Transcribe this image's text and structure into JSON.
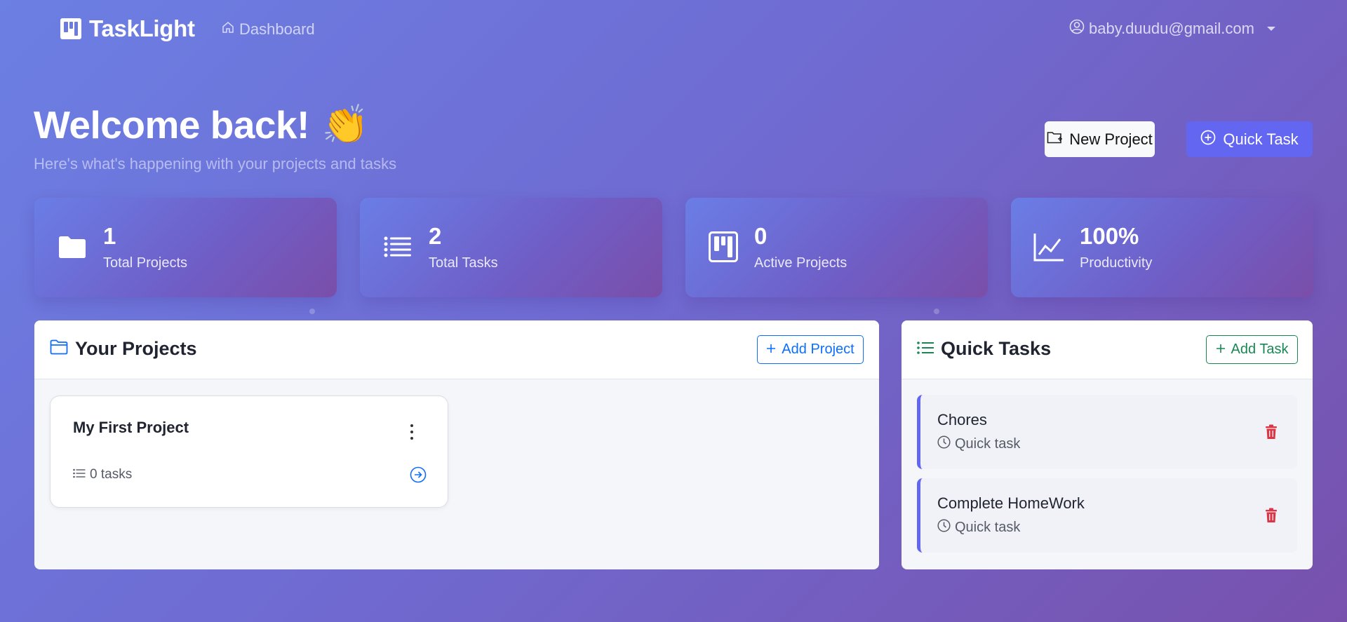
{
  "nav": {
    "brand": "TaskLight",
    "dashboard_link": "Dashboard",
    "user_email": "baby.duudu@gmail.com"
  },
  "hero": {
    "title": "Welcome back!",
    "emoji": "👏",
    "subtitle": "Here's what's happening with your projects and tasks",
    "new_project_label": "New Project",
    "quick_task_label": "Quick Task"
  },
  "stats": [
    {
      "value": "1",
      "label": "Total Projects",
      "icon": "folder-icon"
    },
    {
      "value": "2",
      "label": "Total Tasks",
      "icon": "list-icon"
    },
    {
      "value": "0",
      "label": "Active Projects",
      "icon": "kanban-icon"
    },
    {
      "value": "100%",
      "label": "Productivity",
      "icon": "graph-up-icon"
    }
  ],
  "projects_panel": {
    "title": "Your Projects",
    "add_label": "Add Project",
    "projects": [
      {
        "name": "My First Project",
        "task_count": "0 tasks"
      }
    ]
  },
  "tasks_panel": {
    "title": "Quick Tasks",
    "add_label": "Add Task",
    "tasks": [
      {
        "title": "Chores",
        "meta": "Quick task"
      },
      {
        "title": "Complete HomeWork",
        "meta": "Quick task"
      }
    ]
  },
  "colors": {
    "primary": "#6366f1",
    "link_blue": "#0d6efd",
    "success_green": "#198754",
    "danger_red": "#dc3545"
  }
}
